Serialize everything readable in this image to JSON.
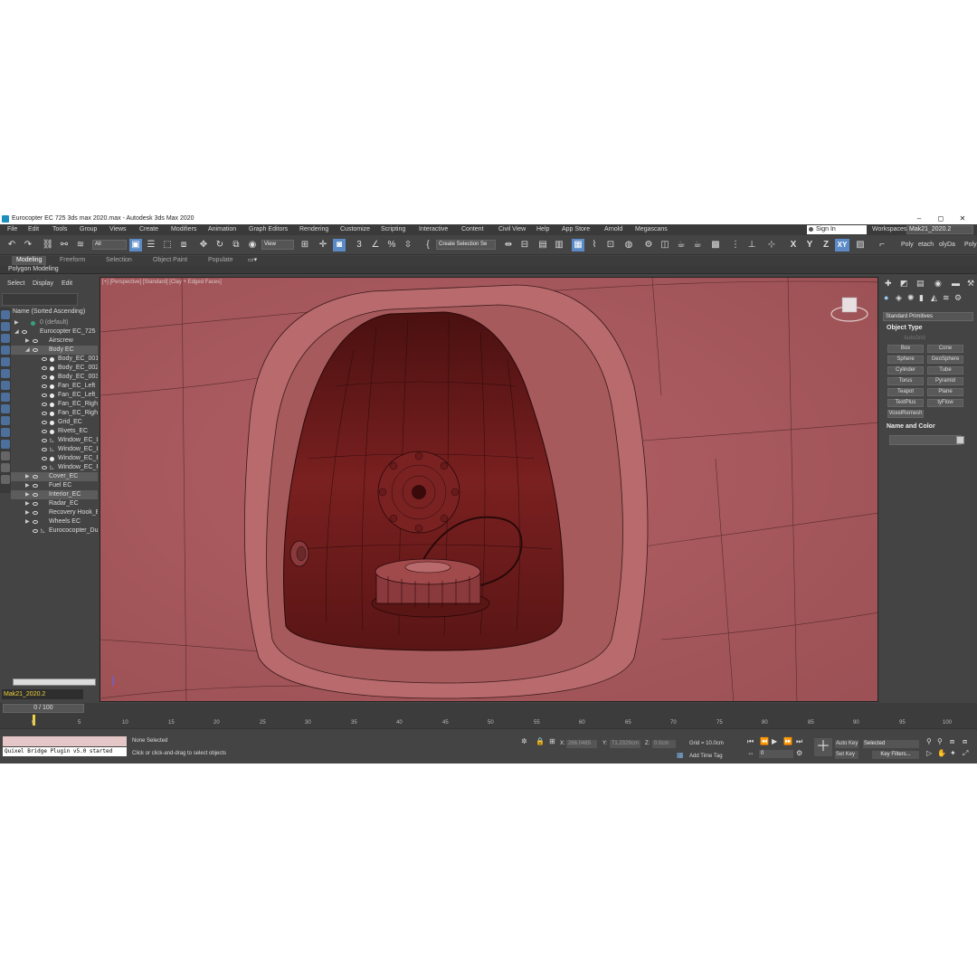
{
  "window": {
    "title": "Eurocopter EC 725 3ds max 2020.max - Autodesk 3ds Max 2020",
    "controls": [
      "–",
      "◻",
      "✕"
    ]
  },
  "menu": [
    "File",
    "Edit",
    "Tools",
    "Group",
    "Views",
    "Create",
    "Modifiers",
    "Animation",
    "Graph Editors",
    "Rendering",
    "Customize",
    "Scripting",
    "Interactive",
    "Content",
    "Civil View",
    "Help",
    "App Store",
    "Arnold",
    "Megascans"
  ],
  "account": {
    "sign_in": "Sign In",
    "workspaces_label": "Workspaces:",
    "workspace": "Mak21_2020.2"
  },
  "toolbar": {
    "filter": "All",
    "ref_coord": "View",
    "selection_set": "Create Selection Se",
    "axes": [
      "X",
      "Y",
      "Z",
      "XY"
    ],
    "right_tabs": [
      "Poly",
      "etach",
      "olyDa",
      "Poly"
    ]
  },
  "ribbon": {
    "tabs": [
      "Modeling",
      "Freeform",
      "Selection",
      "Object Paint",
      "Populate"
    ],
    "sub": "Polygon Modeling"
  },
  "scene_explorer": {
    "tabs": [
      "Select",
      "Display",
      "Edit"
    ],
    "sort_label": "Name (Sorted Ascending)",
    "items": [
      "0 (default)",
      "Eurocopter EC_725",
      "Airscrew",
      "Body EC",
      "Body_EC_001",
      "Body_EC_002",
      "Body_EC_003",
      "Fan_EC_Left",
      "Fan_EC_Left_C",
      "Fan_EC_Right",
      "Fan_EC_Right_",
      "Grid_EC",
      "Rivets_EC",
      "Window_EC_Le",
      "Window_EC_Le",
      "Window_EC_Rig",
      "Window_EC_Rig",
      "Cover_EC",
      "Fuel EC",
      "Interior_EC",
      "Radar_EC",
      "Recovery Hook_EC",
      "Wheels EC",
      "Eurococopter_Dum"
    ],
    "layer": "Mak21_2020.2"
  },
  "viewport": {
    "label": "[+] [Perspective] [Standard] [Clay + Edged Faces]"
  },
  "command_panel": {
    "category": "Standard Primitives",
    "object_type_title": "Object Type",
    "autogrid": "AutoGrid",
    "primitives": [
      "Box",
      "Cone",
      "Sphere",
      "GeoSphere",
      "Cylinder",
      "Tube",
      "Torus",
      "Pyramid",
      "Teapot",
      "Plane",
      "TextPlus",
      "tyFlow",
      "VoxelRemesh"
    ],
    "name_color_title": "Name and Color"
  },
  "timeline": {
    "frame": "0 / 100",
    "ticks": [
      "0",
      "5",
      "10",
      "15",
      "20",
      "25",
      "30",
      "35",
      "40",
      "45",
      "50",
      "55",
      "60",
      "65",
      "70",
      "75",
      "80",
      "85",
      "90",
      "95",
      "100"
    ]
  },
  "status": {
    "plugin": "Quixel Bridge Plugin v5.0 started",
    "selection": "None Selected",
    "prompt": "Click or click-and-drag to select objects",
    "x_label": "X:",
    "x": "266.0485",
    "y_label": "Y:",
    "y": "71.2329cm",
    "z_label": "Z:",
    "z": "0.0cm",
    "grid": "Grid = 10.0cm",
    "add_time_tag": "Add Time Tag",
    "frame_field": "0",
    "auto_key": "Auto Key",
    "set_key": "Set Key",
    "selected": "Selected",
    "key_filters": "Key Filters..."
  }
}
